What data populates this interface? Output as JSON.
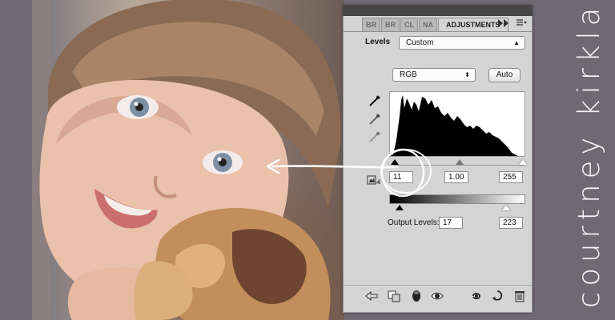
{
  "panel": {
    "tabs": [
      "BR",
      "BR",
      "CL",
      "NA",
      "ADJUSTMENTS"
    ],
    "menu_icons": [
      "fast-forward-icon",
      "panel-menu-icon"
    ],
    "adjustment_label": "Levels",
    "preset_value": "Custom",
    "channel_value": "RGB",
    "auto_label": "Auto",
    "input_levels": {
      "shadow": "11",
      "midtone": "1.00",
      "highlight": "255"
    },
    "output_levels_label": "Output Levels:",
    "output_levels": {
      "low": "17",
      "high": "223"
    },
    "eyedroppers": [
      "black-eyedropper-icon",
      "gray-eyedropper-icon",
      "white-eyedropper-icon"
    ],
    "bottom_icons": [
      "back-arrow-icon",
      "clip-to-layer-icon",
      "layer-mask-icon",
      "visibility-eye-icon",
      "view-previous-icon",
      "reset-icon",
      "trash-icon"
    ]
  },
  "brand": {
    "name": "courtney kirkland"
  },
  "colors": {
    "panel_bg": "#d4d4d4",
    "panel_header": "#474747",
    "brand_band": "#6f6a72",
    "annotation": "#ffffff"
  }
}
